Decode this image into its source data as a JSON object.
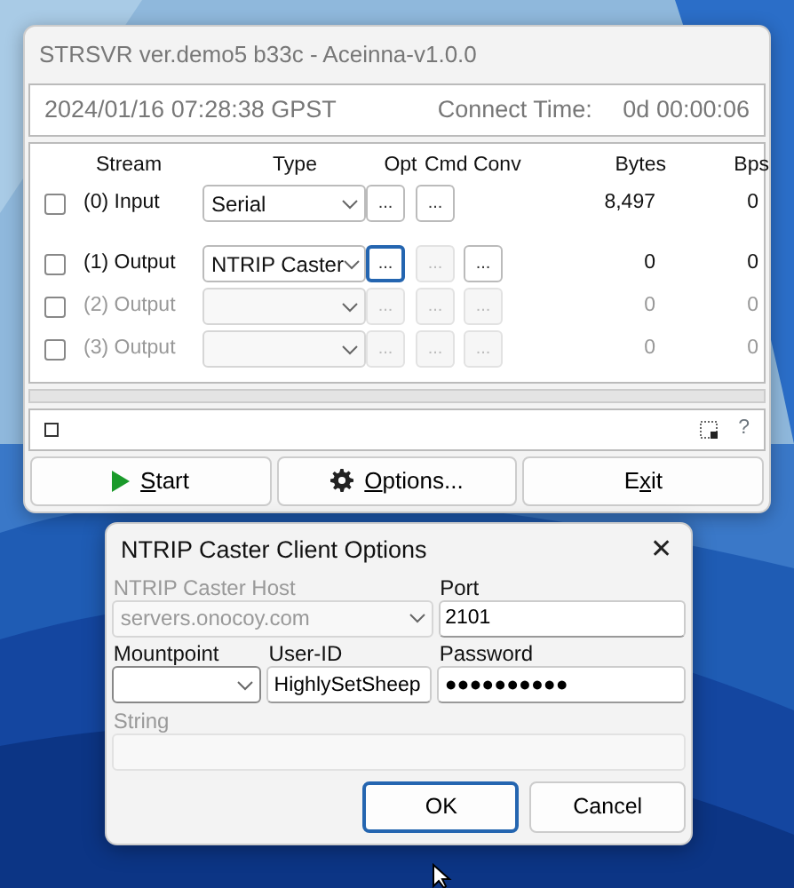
{
  "main_window": {
    "title": "STRSVR ver.demo5 b33c - Aceinna-v1.0.0",
    "time": "2024/01/16 07:28:38 GPST",
    "connect_label": "Connect Time:",
    "connect_time": "0d 00:00:06",
    "columns": [
      "Stream",
      "Type",
      "Opt",
      "Cmd Conv",
      "Bytes",
      "Bps"
    ],
    "streams": [
      {
        "checked": false,
        "disabled": false,
        "label": "(0) Input",
        "type": "Serial",
        "buttons": [
          {
            "kind": "opt",
            "text": "...",
            "disabled": false,
            "focused": false
          },
          {
            "kind": "cmd",
            "text": "...",
            "disabled": false,
            "focused": false
          }
        ],
        "bytes": "8,497",
        "bps": "0"
      },
      {
        "checked": false,
        "disabled": false,
        "label": "(1) Output",
        "type": "NTRIP Caster",
        "buttons": [
          {
            "kind": "opt",
            "text": "...",
            "disabled": false,
            "focused": true
          },
          {
            "kind": "cmd",
            "text": "...",
            "disabled": true,
            "focused": false
          },
          {
            "kind": "conv",
            "text": "...",
            "disabled": false,
            "focused": false
          }
        ],
        "bytes": "0",
        "bps": "0"
      },
      {
        "checked": false,
        "disabled": true,
        "label": "(2) Output",
        "buttons": [
          {
            "kind": "opt",
            "text": "...",
            "disabled": true,
            "focused": false
          },
          {
            "kind": "cmd",
            "text": "...",
            "disabled": true,
            "focused": false
          },
          {
            "kind": "conv",
            "text": "...",
            "disabled": true,
            "focused": false
          }
        ],
        "bytes": "0",
        "bps": "0"
      },
      {
        "checked": false,
        "disabled": true,
        "label": "(3) Output",
        "buttons": [
          {
            "kind": "opt",
            "text": "...",
            "disabled": true,
            "focused": false
          },
          {
            "kind": "cmd",
            "text": "...",
            "disabled": true,
            "focused": false
          },
          {
            "kind": "conv",
            "text": "...",
            "disabled": true,
            "focused": false
          }
        ],
        "bytes": "0",
        "bps": "0"
      }
    ],
    "status_help": "?",
    "buttons": [
      {
        "kind": "start",
        "key": "S",
        "post": "tart"
      },
      {
        "kind": "options",
        "key": "O",
        "post": "ptions..."
      },
      {
        "kind": "exit",
        "pre": "E",
        "key": "x",
        "post": "it"
      }
    ]
  },
  "dialog": {
    "title": "NTRIP Caster Client Options",
    "close": "✕",
    "host": {
      "label": "NTRIP Caster Host",
      "value": "servers.onocoy.com",
      "disabled": true
    },
    "port": {
      "label": "Port",
      "value": "2101"
    },
    "mountpoint": {
      "label": "Mountpoint"
    },
    "user_id": {
      "label": "User-ID",
      "value": "HighlySetSheep"
    },
    "password": {
      "label": "Password",
      "value": "●●●●●●●●●●"
    },
    "string": {
      "label": "String",
      "disabled": true
    },
    "buttons": [
      {
        "text": "OK",
        "focused": true
      },
      {
        "text": "Cancel",
        "focused": false
      }
    ]
  }
}
